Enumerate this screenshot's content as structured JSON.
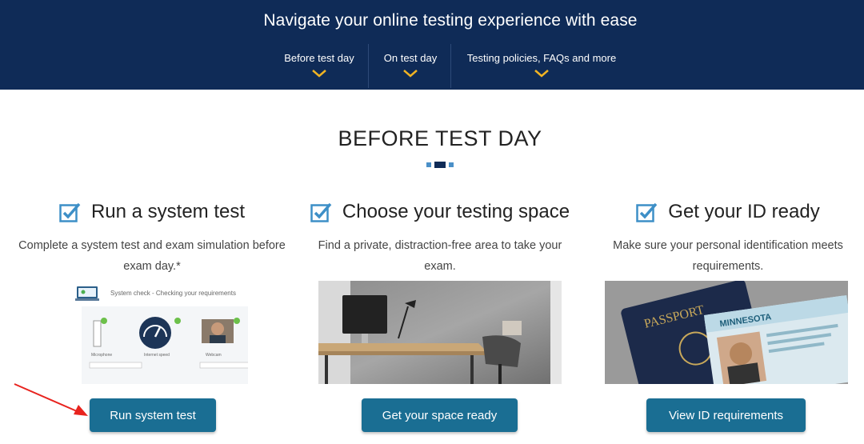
{
  "header": {
    "title": "Navigate your online testing experience with ease",
    "nav": [
      {
        "label": "Before test day"
      },
      {
        "label": "On test day"
      },
      {
        "label": "Testing policies, FAQs and more"
      }
    ]
  },
  "section": {
    "title": "BEFORE TEST DAY"
  },
  "columns": [
    {
      "title": "Run a system test",
      "desc": "Complete a system test and exam simulation before exam day.*",
      "button": "Run system test"
    },
    {
      "title": "Choose your testing space",
      "desc": "Find a private, distraction-free area to take your exam.",
      "button": "Get your space ready"
    },
    {
      "title": "Get your ID ready",
      "desc": "Make sure your personal identification meets requirements.",
      "button": "View ID requirements"
    }
  ],
  "system_check": {
    "title": "System check - Checking your requirements",
    "labels": [
      "Microphone",
      "Internet speed",
      "Webcam"
    ]
  },
  "id_image": {
    "passport_text": "PASSPORT",
    "license_state": "MINNESOTA"
  },
  "colors": {
    "header_bg": "#0f2b57",
    "button_bg": "#1a6e93",
    "accent_gold": "#f0b323",
    "check_blue": "#3d8fc7",
    "arrow_red": "#e8231e"
  }
}
